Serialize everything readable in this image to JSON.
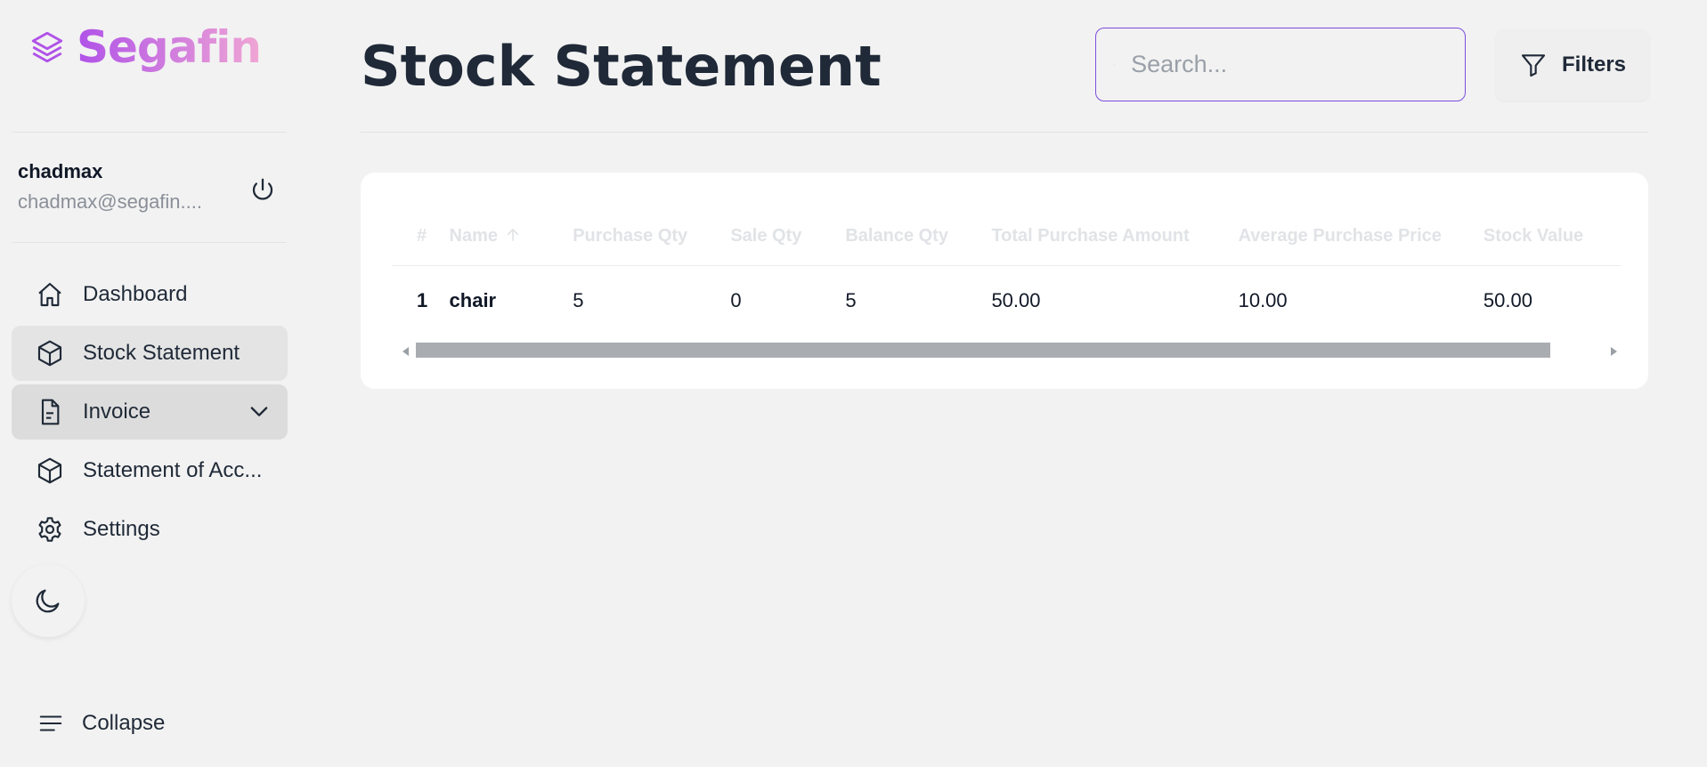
{
  "brand": {
    "name": "Segafin"
  },
  "user": {
    "name": "chadmax",
    "email": "chadmax@segafin...."
  },
  "nav": {
    "items": [
      {
        "label": "Dashboard",
        "icon": "home-icon"
      },
      {
        "label": "Stock Statement",
        "icon": "cube-icon"
      },
      {
        "label": "Invoice",
        "icon": "document-icon"
      },
      {
        "label": "Statement of Acc...",
        "icon": "cube-icon"
      },
      {
        "label": "Settings",
        "icon": "gear-icon"
      }
    ],
    "collapse_label": "Collapse"
  },
  "page": {
    "title": "Stock Statement"
  },
  "search": {
    "placeholder": "Search..."
  },
  "filters": {
    "label": "Filters"
  },
  "table": {
    "headers": [
      "#",
      "Name",
      "Purchase Qty",
      "Sale Qty",
      "Balance Qty",
      "Total Purchase Amount",
      "Average Purchase Price",
      "Stock Value"
    ],
    "rows": [
      [
        "1",
        "chair",
        "5",
        "0",
        "5",
        "50.00",
        "10.00",
        "50.00"
      ]
    ]
  },
  "colors": {
    "accent": "#7c4dde",
    "brand_start": "#b052e8",
    "brand_end": "#f0a6d4",
    "background": "#f2f2f2"
  }
}
